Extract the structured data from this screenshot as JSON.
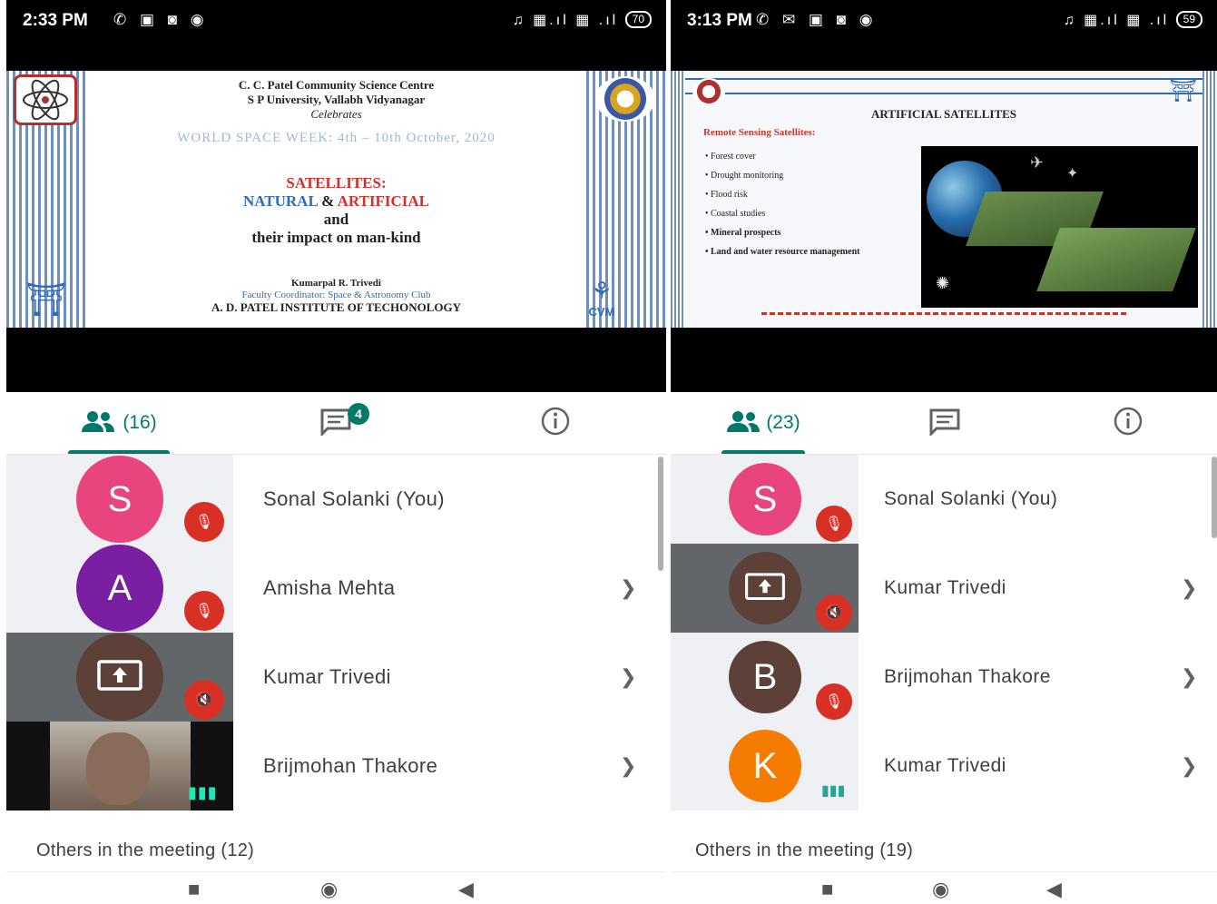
{
  "left": {
    "status": {
      "time": "2:33 PM",
      "battery": "70"
    },
    "slide": {
      "header_line1": "C. C. Patel Community Science Centre",
      "header_line2": "S P University, Vallabh Vidyanagar",
      "header_line3": "Celebrates",
      "banner": "WORLD SPACE WEEK: 4th – 10th October, 2020",
      "title1": "SATELLITES:",
      "title2_a": "NATURAL",
      "title2_amp": "&",
      "title2_b": "ARTIFICIAL",
      "title3": "and",
      "title4": "their impact on man-kind",
      "presenter": "Kumarpal R. Trivedi",
      "presenter_role": "Faculty Coordinator: Space & Astronomy Club",
      "institute": "A. D. PATEL INSTITUTE OF TECHONOLOGY",
      "logo_text": "CVM"
    },
    "tabs": {
      "people_count": "(16)",
      "chat_badge": "4"
    },
    "participants": [
      {
        "initial": "S",
        "name": "Sonal Solanki (You)"
      },
      {
        "initial": "A",
        "name": "Amisha Mehta"
      },
      {
        "initial": "",
        "name": "Kumar Trivedi"
      },
      {
        "initial": "",
        "name": "Brijmohan Thakore"
      }
    ],
    "others": "Others in the meeting (12)"
  },
  "right": {
    "status": {
      "time": "3:13 PM",
      "battery": "59"
    },
    "slide": {
      "title": "ARTIFICIAL SATELLITES",
      "section": "Remote Sensing Satellites:",
      "bullets": [
        "Forest cover",
        "Drought monitoring",
        "Flood risk",
        "Coastal studies",
        "Mineral prospects",
        "Land and water resource management"
      ]
    },
    "tabs": {
      "people_count": "(23)"
    },
    "participants": [
      {
        "initial": "S",
        "name": "Sonal Solanki (You)"
      },
      {
        "initial": "",
        "name": "Kumar Trivedi"
      },
      {
        "initial": "B",
        "name": "Brijmohan Thakore"
      },
      {
        "initial": "K",
        "name": "Kumar Trivedi"
      }
    ],
    "others": "Others in the meeting (19)"
  },
  "colors": {
    "accent": "#00796b",
    "mute": "#d93025",
    "avatar_s": "#e8457f",
    "avatar_a": "#7b1fa2",
    "avatar_b": "#5d4037",
    "avatar_k": "#f57c00"
  }
}
